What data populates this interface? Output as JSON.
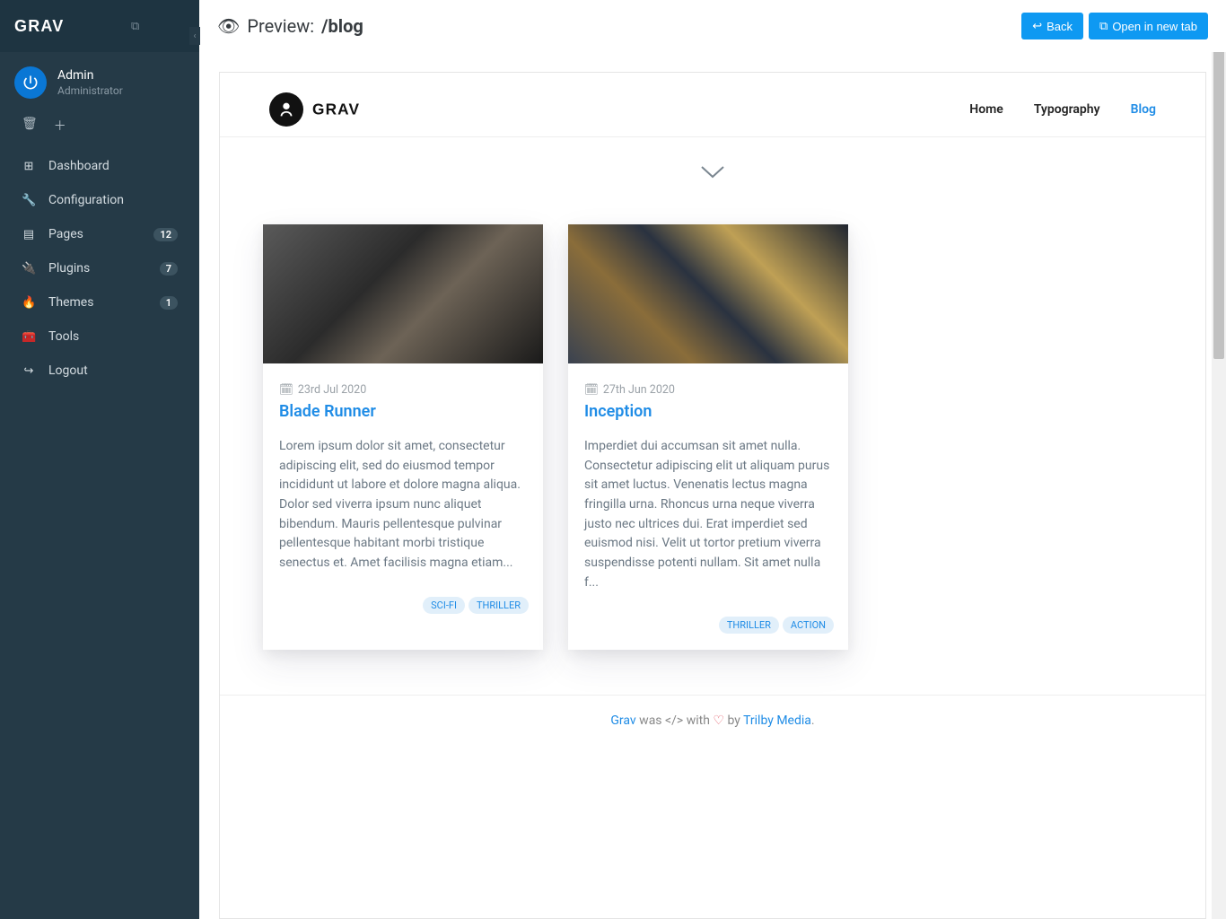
{
  "sidebar": {
    "user": {
      "name": "Admin",
      "role": "Administrator"
    },
    "items": [
      {
        "icon": "⊞",
        "label": "Dashboard",
        "badge": null
      },
      {
        "icon": "🔧",
        "label": "Configuration",
        "badge": null
      },
      {
        "icon": "▤",
        "label": "Pages",
        "badge": "12"
      },
      {
        "icon": "🔌",
        "label": "Plugins",
        "badge": "7"
      },
      {
        "icon": "🔥",
        "label": "Themes",
        "badge": "1"
      },
      {
        "icon": "🧰",
        "label": "Tools",
        "badge": null
      },
      {
        "icon": "↪",
        "label": "Logout",
        "badge": null
      }
    ]
  },
  "topbar": {
    "prefix": "Preview:",
    "path": "/blog",
    "back": "Back",
    "open": "Open in new tab"
  },
  "site": {
    "brand": "GRAV",
    "nav": [
      {
        "label": "Home",
        "active": false
      },
      {
        "label": "Typography",
        "active": false
      },
      {
        "label": "Blog",
        "active": true
      }
    ]
  },
  "posts": [
    {
      "date": "23rd Jul 2020",
      "title": "Blade Runner",
      "text": "Lorem ipsum dolor sit amet, consectetur adipiscing elit, sed do eiusmod tempor incididunt ut labore et dolore magna aliqua. Dolor sed viverra ipsum nunc aliquet bibendum. Mauris pellentesque pulvinar pellentesque habitant morbi tristique senectus et. Amet facilisis magna etiam...",
      "tags": [
        "SCI-FI",
        "THRILLER"
      ],
      "imgClass": "bg1"
    },
    {
      "date": "27th Jun 2020",
      "title": "Inception",
      "text": "Imperdiet dui accumsan sit amet nulla. Consectetur adipiscing elit ut aliquam purus sit amet luctus. Venenatis lectus magna fringilla urna. Rhoncus urna neque viverra justo nec ultrices dui. Erat imperdiet sed euismod nisi. Velit ut tortor pretium viverra suspendisse potenti nullam. Sit amet nulla f...",
      "tags": [
        "THRILLER",
        "ACTION"
      ],
      "imgClass": "bg2"
    }
  ],
  "footer": {
    "grav": "Grav",
    "was": " was ",
    "with": " with ",
    "by": " by ",
    "trilby": "Trilby Media",
    "period": "."
  }
}
